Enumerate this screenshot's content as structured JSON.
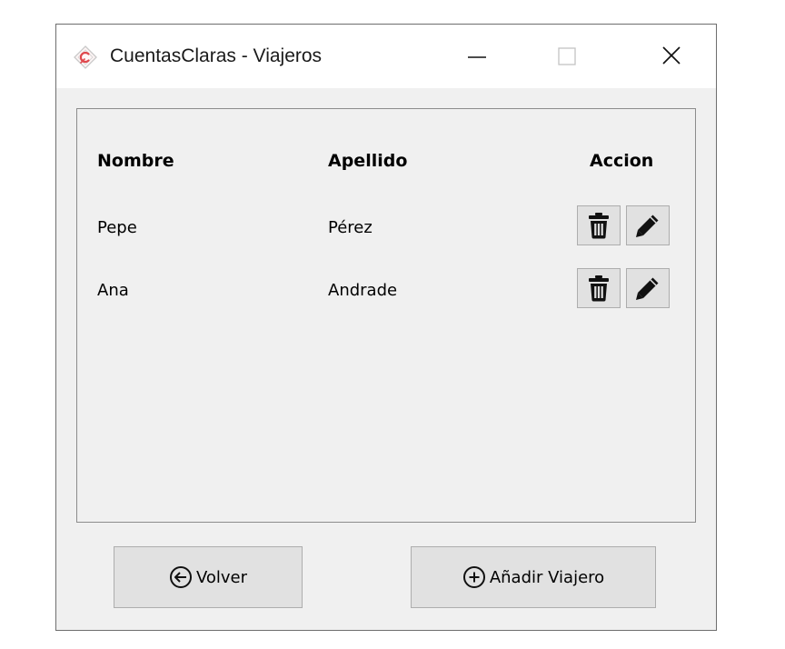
{
  "window": {
    "title": "CuentasClaras - Viajeros",
    "app_icon": "cuentasclaras-logo-icon",
    "controls": [
      "minimize-icon",
      "maximize-icon",
      "close-icon"
    ]
  },
  "table": {
    "headers": {
      "nombre": "Nombre",
      "apellido": "Apellido",
      "accion": "Accion"
    },
    "rows": [
      {
        "nombre": "Pepe",
        "apellido": "Pérez"
      },
      {
        "nombre": "Ana",
        "apellido": "Andrade"
      }
    ],
    "row_actions": [
      "trash-icon",
      "pencil-icon"
    ]
  },
  "footer": {
    "back_label": "Volver",
    "back_icon": "arrow-left-circle-icon",
    "add_label": "Añadir Viajero",
    "add_icon": "plus-circle-icon"
  },
  "colors": {
    "window_bg": "#f0f0f0",
    "titlebar_bg": "#ffffff",
    "button_bg": "#e1e1e1",
    "button_border": "#adadad",
    "logo_accent": "#e0474c"
  }
}
